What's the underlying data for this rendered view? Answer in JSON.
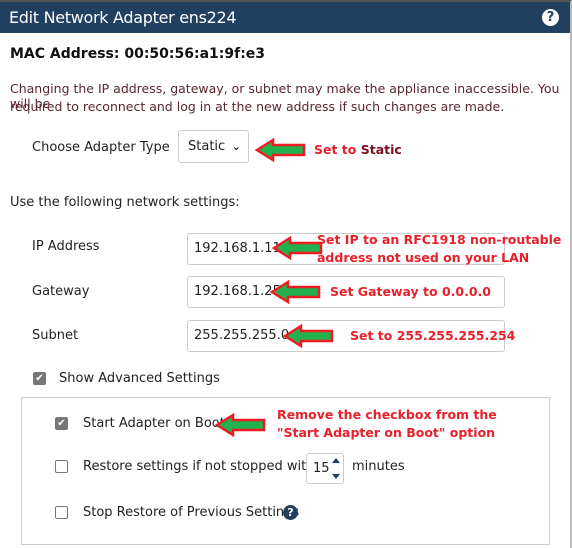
{
  "dialog": {
    "title": "Edit Network Adapter ens224",
    "help_icon": "question-circle-icon",
    "mac_address": "MAC Address: 00:50:56:a1:9f:e3",
    "warning_line1": "Changing the IP address, gateway, or subnet may make the appliance inaccessible. You will be",
    "warning_line2": "required to reconnect and log in at the new address if such changes are made.",
    "adapter_type_label": "Choose Adapter Type",
    "adapter_type_value": "Static",
    "settings_heading": "Use the following network settings:",
    "ip_label": "IP Address",
    "ip_value": "192.168.1.11",
    "gateway_label": "Gateway",
    "gateway_value": "192.168.1.254",
    "subnet_label": "Subnet",
    "subnet_value": "255.255.255.0",
    "show_advanced_label": "Show Advanced Settings",
    "show_advanced_checked": true,
    "advanced": {
      "start_on_boot_label": "Start Adapter on Boot",
      "start_on_boot_checked": true,
      "restore_label": "Restore settings if not stopped within",
      "restore_checked": false,
      "restore_minutes": "15",
      "minutes_label": "minutes",
      "stop_restore_label": "Stop Restore of Previous Settings",
      "stop_restore_checked": false
    }
  },
  "annotations": {
    "color_text": "#e8202a",
    "color_arrow_fill": "#22b14c",
    "color_arrow_stroke": "#ed1c24",
    "adapter_prefix": "Set to ",
    "adapter_emph": "Static",
    "ip_line1": "Set IP to an RFC1918 non-routable",
    "ip_line2": "address not used on your LAN",
    "gateway": "Set Gateway to 0.0.0.0",
    "subnet": "Set to 255.255.255.254",
    "boot_line1": "Remove the checkbox from the",
    "boot_line2": "\"Start Adapter on Boot\" option"
  }
}
